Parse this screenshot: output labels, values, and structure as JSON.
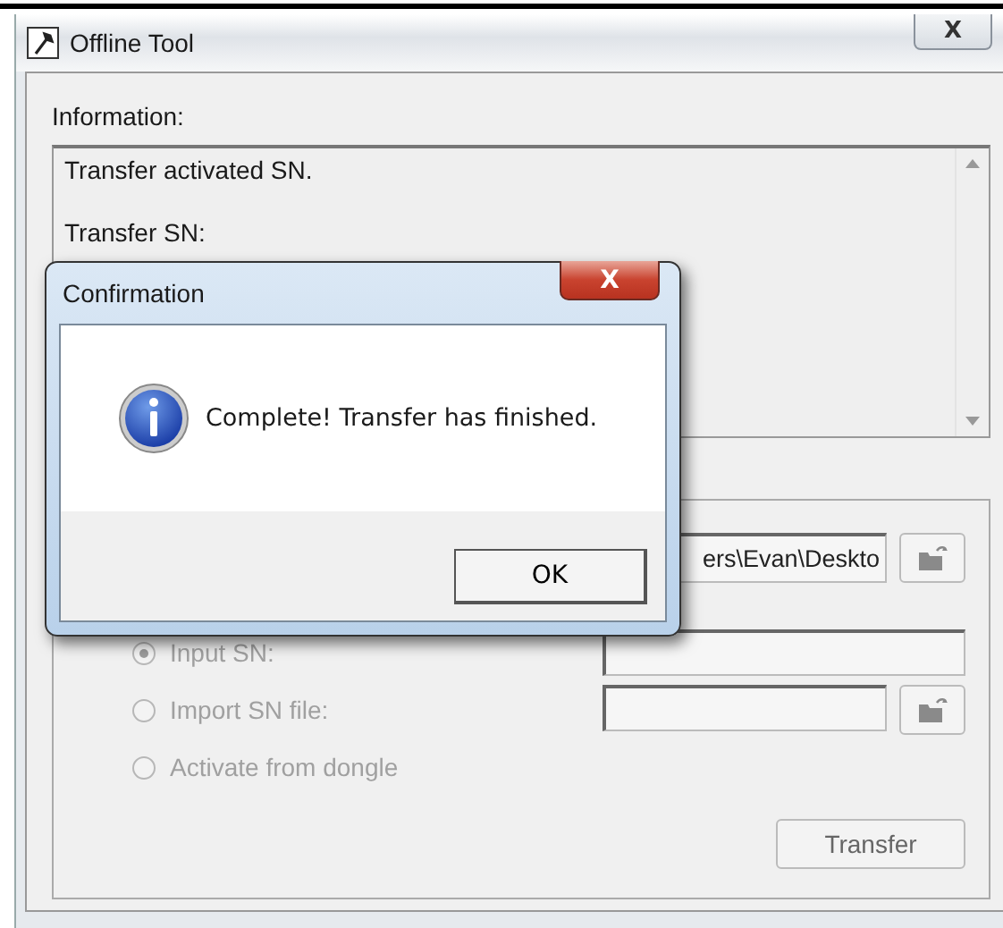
{
  "window": {
    "title": "Offline Tool",
    "close": "X"
  },
  "information": {
    "label": "Information:",
    "lines": [
      "Transfer activated SN.",
      "Transfer SN:"
    ]
  },
  "path_field": {
    "value": "ers\\Evan\\Deskto"
  },
  "options": [
    {
      "label": "Input SN:",
      "selected": true,
      "disabled": true,
      "kind": "text"
    },
    {
      "label": "Import SN file:",
      "selected": false,
      "disabled": true,
      "kind": "file"
    },
    {
      "label": "Activate from dongle",
      "selected": false,
      "disabled": true,
      "kind": "plain"
    }
  ],
  "transfer_button": {
    "label": "Transfer"
  },
  "dialog": {
    "title": "Confirmation",
    "close": "X",
    "message": "Complete! Transfer has finished.",
    "button": "OK"
  }
}
